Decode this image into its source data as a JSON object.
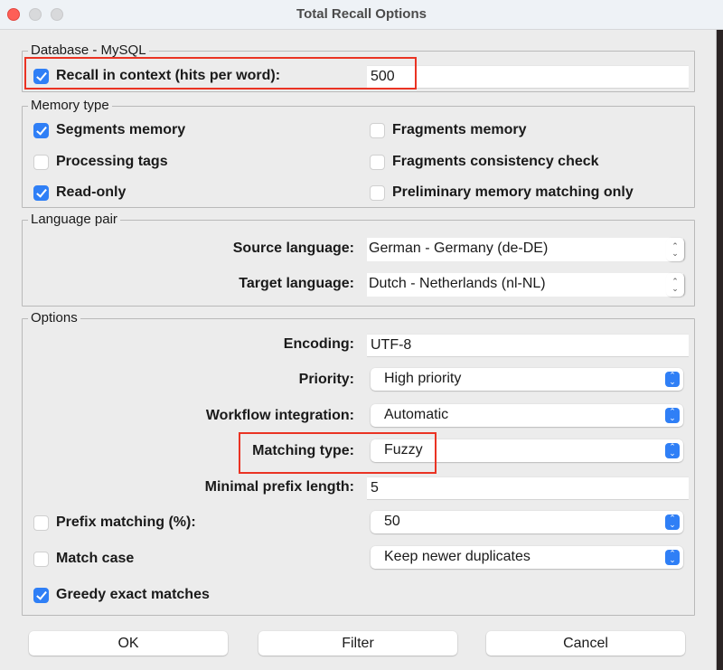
{
  "window": {
    "title": "Total Recall Options"
  },
  "database": {
    "group_label": "Database - MySQL",
    "recall_in_context": {
      "label": "Recall in context (hits per word):",
      "checked": true,
      "value": "500"
    }
  },
  "memory_type": {
    "group_label": "Memory type",
    "options": [
      {
        "label": "Segments memory",
        "checked": true
      },
      {
        "label": "Fragments memory",
        "checked": false
      },
      {
        "label": "Processing tags",
        "checked": false
      },
      {
        "label": "Fragments consistency check",
        "checked": false
      },
      {
        "label": "Read-only",
        "checked": true
      },
      {
        "label": "Preliminary memory matching only",
        "checked": false
      }
    ]
  },
  "language_pair": {
    "group_label": "Language pair",
    "source_label": "Source language:",
    "source_value": "German - Germany (de-DE)",
    "target_label": "Target language:",
    "target_value": "Dutch - Netherlands (nl-NL)"
  },
  "options": {
    "group_label": "Options",
    "encoding_label": "Encoding:",
    "encoding_value": "UTF-8",
    "priority_label": "Priority:",
    "priority_value": "High priority",
    "workflow_label": "Workflow integration:",
    "workflow_value": "Automatic",
    "matching_type_label": "Matching type:",
    "matching_type_value": "Fuzzy",
    "min_prefix_label": "Minimal prefix length:",
    "min_prefix_value": "5",
    "prefix_matching": {
      "label": "Prefix matching (%):",
      "checked": false,
      "value": "50"
    },
    "match_case": {
      "label": "Match case",
      "checked": false
    },
    "duplicates_value": "Keep newer duplicates",
    "greedy_exact": {
      "label": "Greedy exact matches",
      "checked": true
    }
  },
  "buttons": {
    "ok": "OK",
    "filter": "Filter",
    "cancel": "Cancel"
  },
  "colors": {
    "accent": "#2f7ff6",
    "highlight": "#ea3323"
  }
}
